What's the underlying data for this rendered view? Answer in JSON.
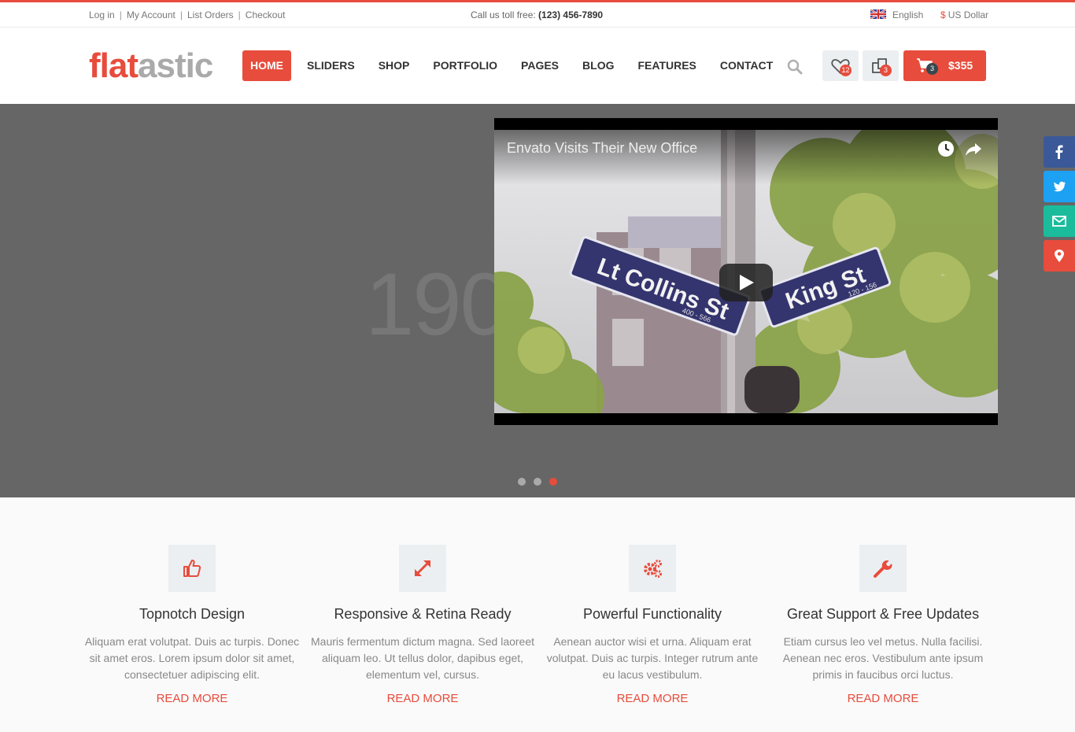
{
  "topbar": {
    "links": [
      "Log in",
      "My Account",
      "List Orders",
      "Checkout"
    ],
    "phone_label": "Call us toll free:",
    "phone_number": "(123) 456-7890",
    "language": "English",
    "currency_symbol": "$",
    "currency": "US Dollar"
  },
  "logo": {
    "part1": "flat",
    "part2": "astic"
  },
  "nav": {
    "items": [
      "HOME",
      "SLIDERS",
      "SHOP",
      "PORTFOLIO",
      "PAGES",
      "BLOG",
      "FEATURES",
      "CONTACT"
    ],
    "active": "HOME"
  },
  "header": {
    "wishlist_count": "12",
    "compare_count": "3",
    "cart_count": "3",
    "cart_total": "$355"
  },
  "slider": {
    "big_number": "190",
    "video_title": "Envato Visits Their New Office",
    "sign_left": "Lt Collins St",
    "sign_left_sub": "400 - 566",
    "sign_right": "King St",
    "sign_right_sub": "120 - 156",
    "active_slide": 3,
    "slide_count": 3
  },
  "features": [
    {
      "icon": "thumbs-up-icon",
      "title": "Topnotch Design",
      "text": "Aliquam erat volutpat. Duis ac turpis. Donec sit amet eros. Lorem ipsum dolor sit amet, consectetuer adipiscing elit.",
      "more": "READ MORE"
    },
    {
      "icon": "expand-icon",
      "title": "Responsive & Retina Ready",
      "text": "Mauris fermentum dictum magna. Sed laoreet aliquam leo. Ut tellus dolor, dapibus eget, elementum vel, cursus.",
      "more": "READ MORE"
    },
    {
      "icon": "gears-icon",
      "title": "Powerful Functionality",
      "text": "Aenean auctor wisi et urna. Aliquam erat volutpat. Duis ac turpis. Integer rutrum ante eu lacus vestibulum.",
      "more": "READ MORE"
    },
    {
      "icon": "wrench-icon",
      "title": "Great Support & Free Updates",
      "text": "Etiam cursus leo vel metus. Nulla facilisi. Aenean nec eros. Vestibulum ante ipsum primis in faucibus orci luctus.",
      "more": "READ MORE"
    }
  ],
  "social": [
    "facebook-icon",
    "twitter-icon",
    "email-icon",
    "location-icon"
  ],
  "colors": {
    "accent": "#e74c3c",
    "slider_bg": "#666666",
    "facebook": "#3b5998",
    "twitter": "#1da1f2",
    "email": "#1abc9c",
    "location": "#e74c3c"
  }
}
